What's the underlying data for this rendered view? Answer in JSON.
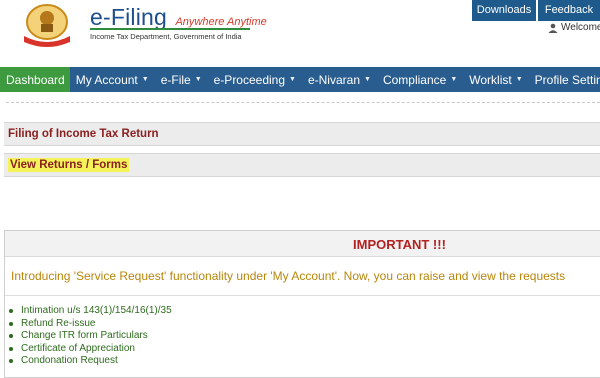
{
  "header": {
    "brand_title": "e-Filing",
    "brand_tagline": "Anywhere Anytime",
    "brand_subtitle": "Income Tax Department, Government of India",
    "downloads_label": "Downloads",
    "feedback_label": "Feedback",
    "welcome_text": "Welcome"
  },
  "nav": {
    "items": [
      {
        "label": "Dashboard",
        "active": true
      },
      {
        "label": "My Account"
      },
      {
        "label": "e-File"
      },
      {
        "label": "e-Proceeding"
      },
      {
        "label": "e-Nivaran"
      },
      {
        "label": "Compliance"
      },
      {
        "label": "Worklist"
      },
      {
        "label": "Profile Settings"
      }
    ]
  },
  "sections": {
    "filing_title": "Filing of Income Tax Return",
    "view_returns_label": "View Returns / Forms"
  },
  "important": {
    "title": "IMPORTANT !!!",
    "message": "Introducing 'Service Request' functionality under 'My Account'. Now, you can raise and view the requests",
    "items": [
      "Intimation u/s 143(1)/154/16(1)/35",
      "Refund Re-issue",
      "Change ITR form Particulars",
      "Certificate of Appreciation",
      "Condonation Request"
    ]
  },
  "colors": {
    "nav_bg": "#2a5d8f",
    "nav_active": "#3e9a3e",
    "section_title": "#8b2020",
    "important_title": "#b22222",
    "list_text": "#2e6b1e"
  }
}
